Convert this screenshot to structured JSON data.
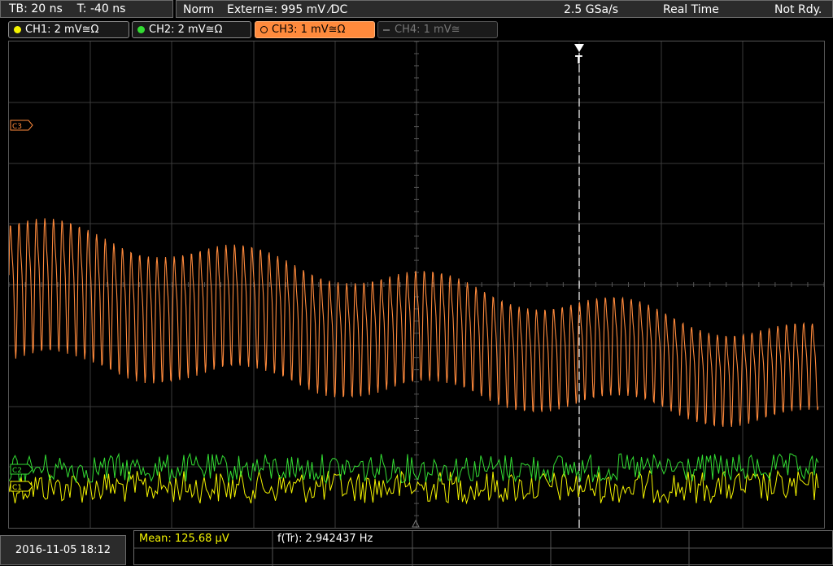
{
  "header": {
    "timebase": "TB: 20 ns",
    "trigger_time": "T: -40 ns",
    "trigger_mode": "Norm",
    "trigger_source": "Extern≅: 995 mV ⁄DC",
    "sample_rate": "2.5 GSa/s",
    "acq_mode": "Real Time",
    "status": "Not Rdy."
  },
  "channels": [
    {
      "label": "CH1: 2 mV≅Ω",
      "color": "#f4f400",
      "active": true
    },
    {
      "label": "CH2: 2 mV≅Ω",
      "color": "#33dd33",
      "active": true
    },
    {
      "label": "CH3: 1 mV≅Ω",
      "color": "#ff8a3c",
      "active": true,
      "selected": true
    },
    {
      "label": "CH4: 1 mV≅",
      "color": "#777777",
      "active": false
    }
  ],
  "markers": {
    "ch3": "C3",
    "ch2": "C2",
    "ch1": "C1",
    "trigger": "T"
  },
  "footer": {
    "datetime": "2016-11-05 18:12",
    "mean": "Mean: 125.68 µV",
    "freq": "f(Tr): 2.942437 Hz"
  },
  "colors": {
    "grid": "#3a3a3a",
    "ch1": "#f4f400",
    "ch2": "#33dd33",
    "ch3": "#ff8a3c"
  }
}
